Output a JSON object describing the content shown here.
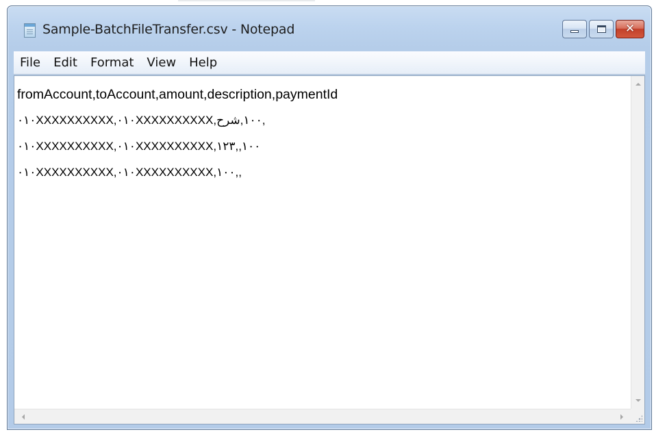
{
  "window": {
    "title": "Sample-BatchFileTransfer.csv - Notepad"
  },
  "icons": {
    "app": "notepad-icon",
    "minimize": "minimize-icon",
    "maximize": "maximize-icon",
    "close": "close-icon",
    "close_glyph": "✕"
  },
  "menu": {
    "items": [
      "File",
      "Edit",
      "Format",
      "View",
      "Help"
    ]
  },
  "document": {
    "lines": [
      "fromAccount,toAccount,amount,description,paymentId",
      "٠١٠XXXXXXXXXX,٠١٠XXXXXXXXXX,١٠٠,شرح,",
      "٠١٠XXXXXXXXXX,٠١٠XXXXXXXXXX,١٠٠,,١٢٣",
      "٠١٠XXXXXXXXXX,٠١٠XXXXXXXXXX,١٠٠,,"
    ]
  },
  "colors": {
    "title_bar": "#bcd3ee",
    "close_button": "#c2402a",
    "menu_bar": "#f3f7fc",
    "text": "#000000"
  }
}
